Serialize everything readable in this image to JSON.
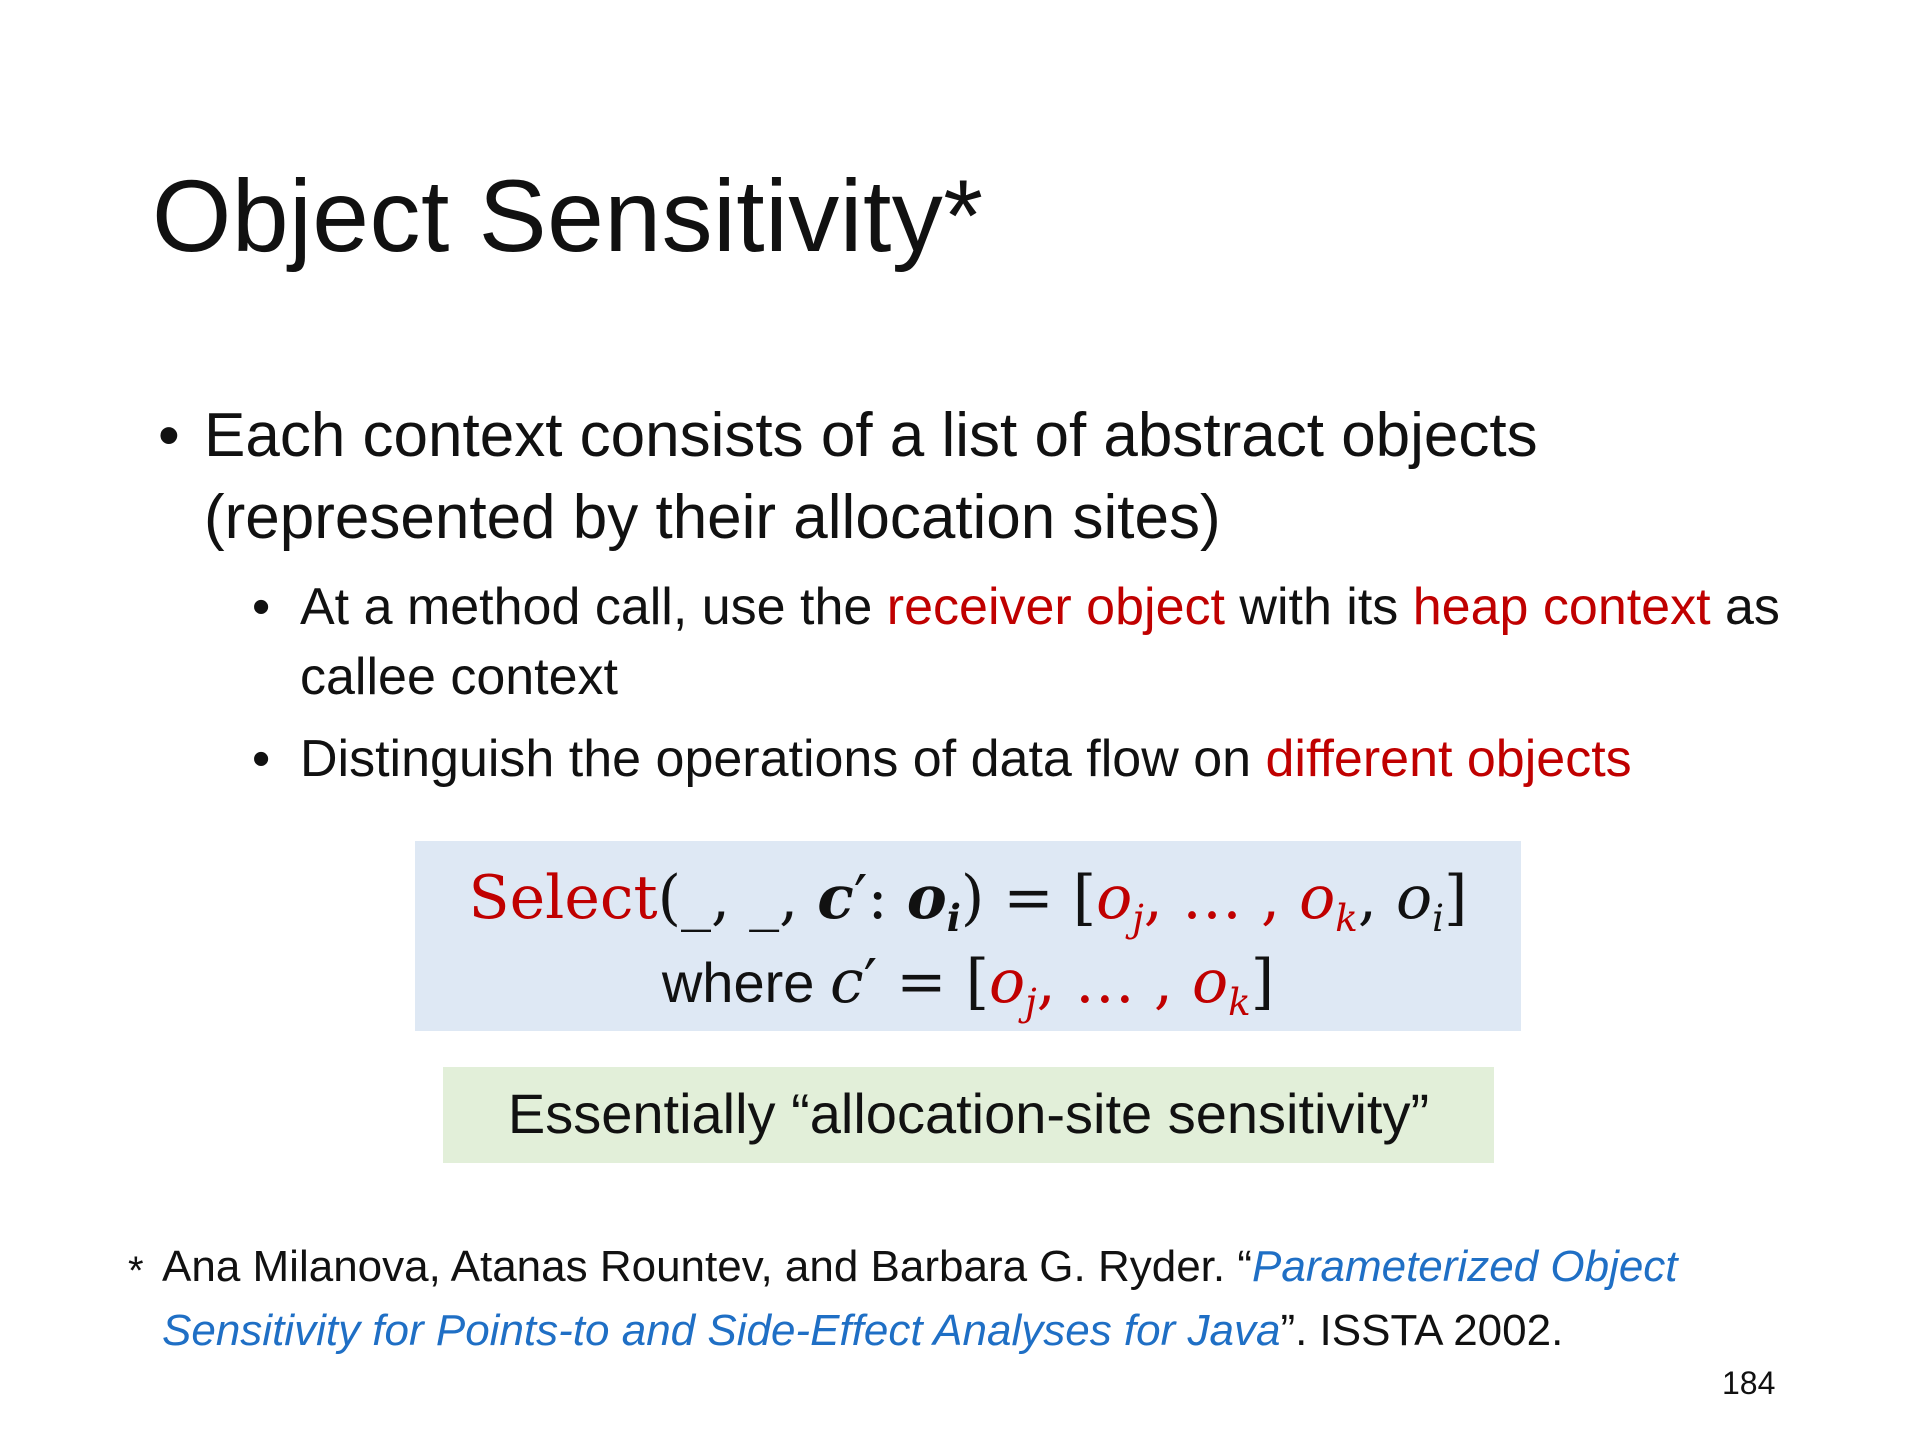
{
  "title": "Object Sensitivity*",
  "bullets": {
    "b1": "Each context consists of a list of abstract objects (represented by their allocation sites)",
    "b2": {
      "p1": "At a method call, use the ",
      "h1": "receiver object",
      "p2": " with its ",
      "h2": "heap context",
      "p3": " as callee context"
    },
    "b3": {
      "p1": "Distinguish the operations of data flow on ",
      "h1": "different objects"
    },
    "dot": "•"
  },
  "formula": {
    "select": "Select",
    "args": "(_, _, ",
    "c": "c",
    "prime": "′",
    "colon": ": ",
    "o": "o",
    "i": "i",
    "close_eq": ") = [",
    "j": "j",
    "k": "k",
    "dots": ", … , ",
    "comma": ", ",
    "rbracket": "]",
    "where": "where ",
    "eq": " = ["
  },
  "note": "Essentially “allocation-site sensitivity”",
  "footnote": {
    "star": "*",
    "authors": "Ana Milanova, Atanas Rountev, and Barbara G. Ryder. “",
    "paper": "Parameterized Object Sensitivity for Points-to and Side-Effect Analyses for Java",
    "venue": "”. ISSTA 2002."
  },
  "page_number": "184",
  "colors": {
    "highlight": "#c00000",
    "citation": "#1f6fc5",
    "formula_bg": "#dee8f4",
    "note_bg": "#e2efd9"
  }
}
